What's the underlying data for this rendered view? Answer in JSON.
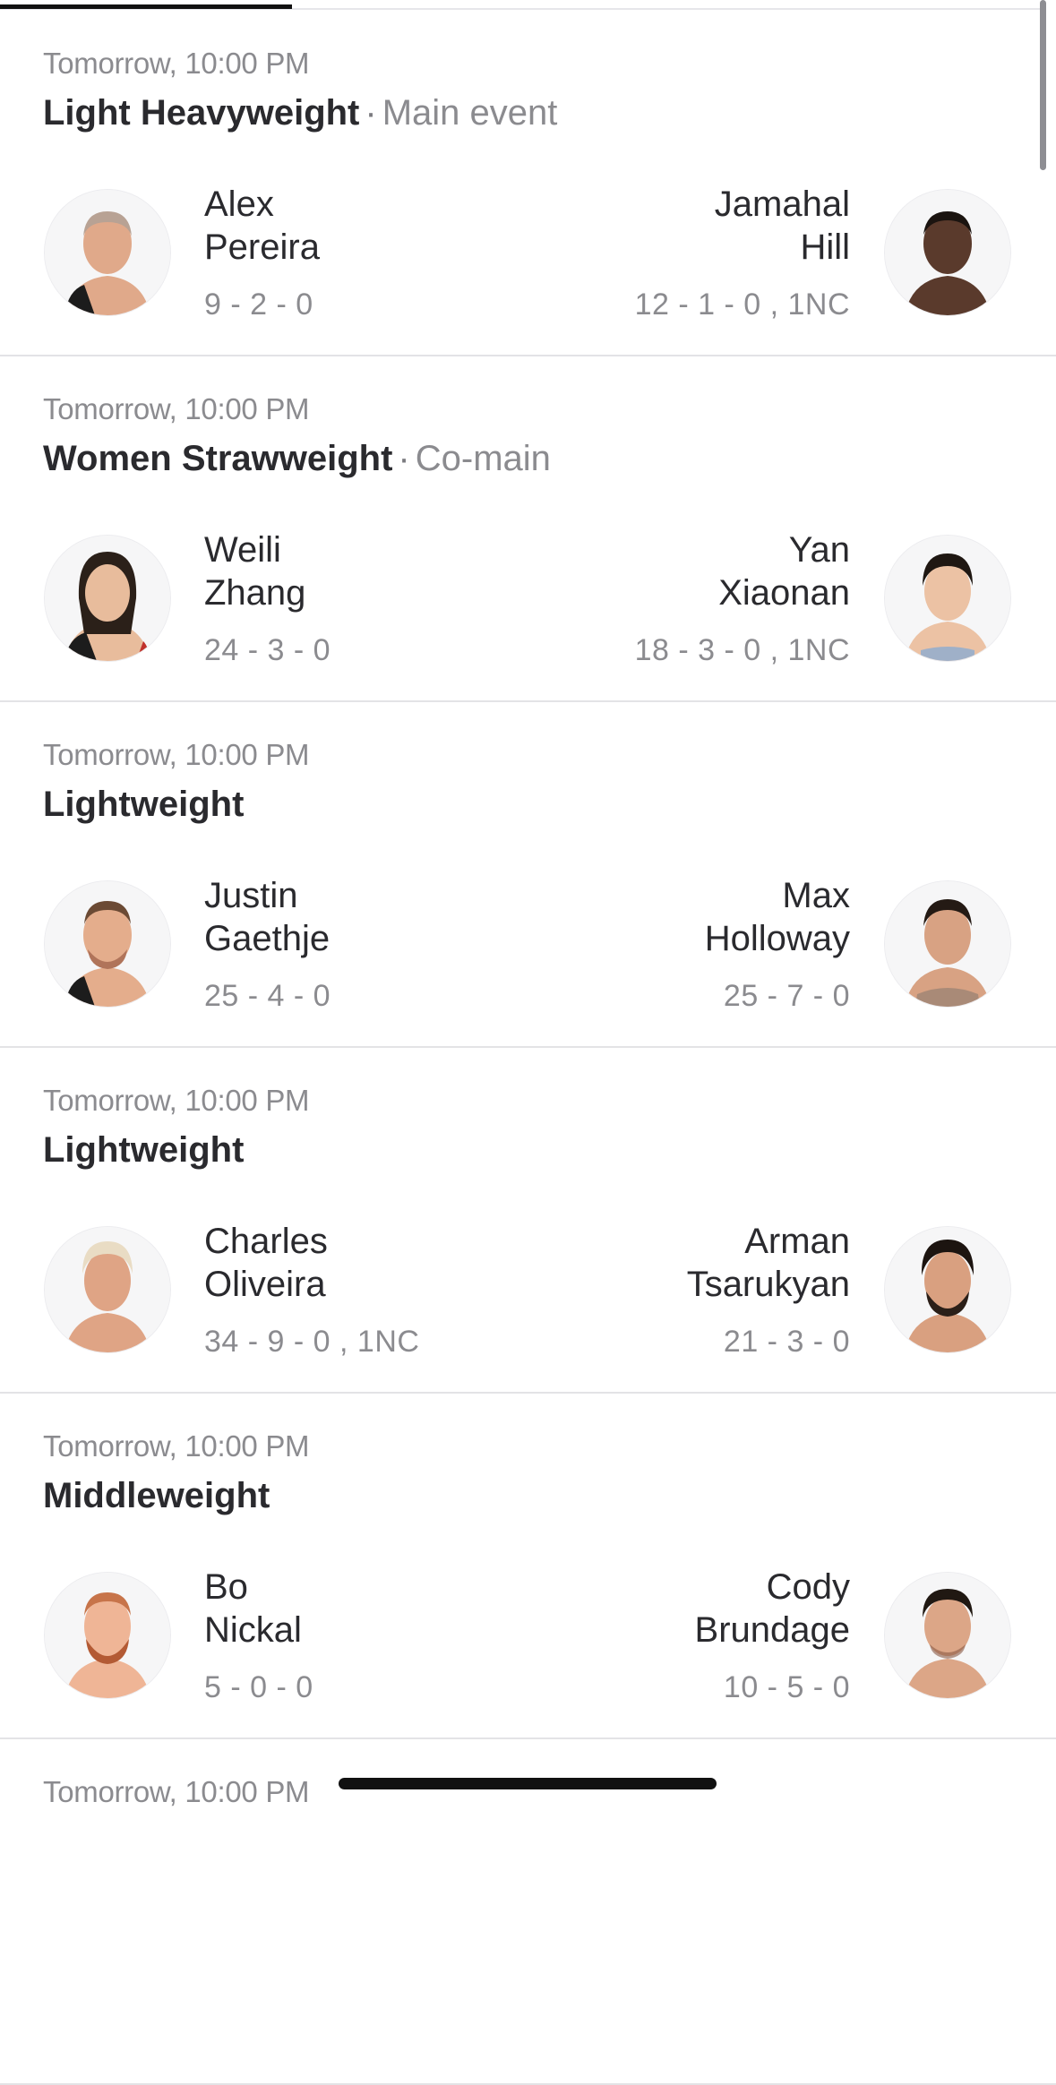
{
  "tabs": {
    "active_index": 0
  },
  "fights": [
    {
      "time": "Tomorrow, 10:00 PM",
      "weight_class": "Light Heavyweight",
      "separator": "·",
      "event_label": "Main event",
      "red": {
        "first": "Alex",
        "last": "Pereira",
        "record": "9 - 2 - 0"
      },
      "blue": {
        "first": "Jamahal",
        "last": "Hill",
        "record": "12 - 1 - 0 , 1NC"
      }
    },
    {
      "time": "Tomorrow, 10:00 PM",
      "weight_class": "Women Strawweight",
      "separator": "·",
      "event_label": "Co-main",
      "red": {
        "first": "Weili",
        "last": "Zhang",
        "record": "24 - 3 - 0"
      },
      "blue": {
        "first": "Yan",
        "last": "Xiaonan",
        "record": "18 - 3 - 0 , 1NC"
      }
    },
    {
      "time": "Tomorrow, 10:00 PM",
      "weight_class": "Lightweight",
      "separator": "",
      "event_label": "",
      "red": {
        "first": "Justin",
        "last": "Gaethje",
        "record": "25 - 4 - 0"
      },
      "blue": {
        "first": "Max",
        "last": "Holloway",
        "record": "25 - 7 - 0"
      }
    },
    {
      "time": "Tomorrow, 10:00 PM",
      "weight_class": "Lightweight",
      "separator": "",
      "event_label": "",
      "red": {
        "first": "Charles",
        "last": "Oliveira",
        "record": "34 - 9 - 0 , 1NC"
      },
      "blue": {
        "first": "Arman",
        "last": "Tsarukyan",
        "record": "21 - 3 - 0"
      }
    },
    {
      "time": "Tomorrow, 10:00 PM",
      "weight_class": "Middleweight",
      "separator": "",
      "event_label": "",
      "red": {
        "first": "Bo",
        "last": "Nickal",
        "record": "5 - 0 - 0"
      },
      "blue": {
        "first": "Cody",
        "last": "Brundage",
        "record": "10 - 5 - 0"
      }
    },
    {
      "time": "Tomorrow, 10:00 PM",
      "weight_class": "",
      "separator": "",
      "event_label": "",
      "red": {
        "first": "",
        "last": "",
        "record": ""
      },
      "blue": {
        "first": "",
        "last": "",
        "record": ""
      }
    }
  ],
  "icons": {
    "avatar": "fighter-headshot-icon"
  },
  "colors": {
    "background": "#ffffff",
    "text_primary": "#2a2a2e",
    "text_secondary": "#8b8b8f",
    "divider": "#e3e3e6",
    "tab_active": "#111111",
    "skin_tone": "#e0a98a",
    "hair": "#2b2019"
  }
}
